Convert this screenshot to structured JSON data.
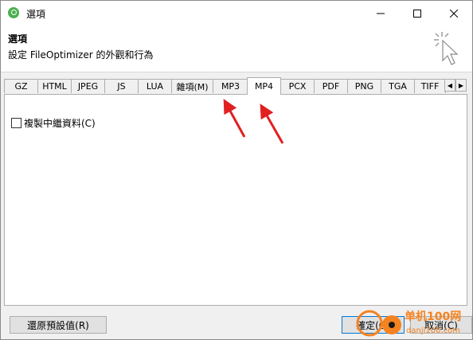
{
  "window": {
    "title": "選項",
    "icons": {
      "app": "fileoptimizer-app-icon",
      "minimize": "minimize-icon",
      "maximize": "maximize-icon",
      "close": "close-icon"
    }
  },
  "header": {
    "title": "選項",
    "description": "設定 FileOptimizer 的外觀和行為",
    "icon": "cursor-click-icon"
  },
  "tabs": [
    {
      "label": "GZ",
      "active": false
    },
    {
      "label": "HTML",
      "active": false
    },
    {
      "label": "JPEG",
      "active": false
    },
    {
      "label": "JS",
      "active": false
    },
    {
      "label": "LUA",
      "active": false
    },
    {
      "label": "雜項(M)",
      "active": false
    },
    {
      "label": "MP3",
      "active": false
    },
    {
      "label": "MP4",
      "active": true
    },
    {
      "label": "PCX",
      "active": false
    },
    {
      "label": "PDF",
      "active": false
    },
    {
      "label": "PNG",
      "active": false
    },
    {
      "label": "TGA",
      "active": false
    },
    {
      "label": "TIFF",
      "active": false
    }
  ],
  "tab_scroll": {
    "left": "◀",
    "right": "▶"
  },
  "panel": {
    "copy_metadata": {
      "label": "複製中繼資料(C)",
      "checked": false
    }
  },
  "buttons": {
    "restore": "還原預設值(R)",
    "ok": "確定(O)",
    "cancel": "取消(C)"
  },
  "annotations": {
    "arrow_color": "#e02020"
  },
  "watermark": {
    "line1": "单机100网",
    "line2": "danji100.com"
  }
}
